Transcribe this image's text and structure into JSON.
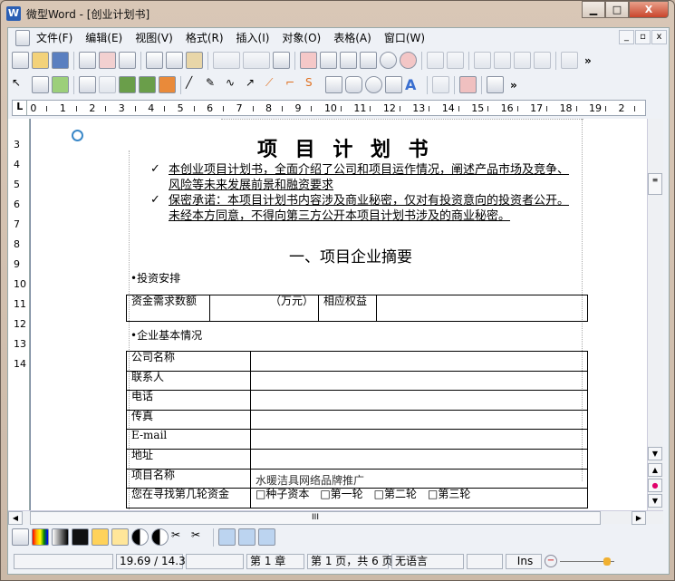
{
  "window": {
    "title": "微型Word - [创业计划书]",
    "app_icon": "W"
  },
  "menu": [
    "文件(F)",
    "编辑(E)",
    "视图(V)",
    "格式(R)",
    "插入(I)",
    "对象(O)",
    "表格(A)",
    "窗口(W)"
  ],
  "ruler": {
    "corner": "L",
    "h": [
      "0",
      "1",
      "2",
      "3",
      "4",
      "5",
      "6",
      "7",
      "8",
      "9",
      "10",
      "11",
      "12",
      "13",
      "14",
      "15",
      "16",
      "17",
      "18",
      "19",
      "2"
    ],
    "v": [
      "3",
      "4",
      "5",
      "6",
      "7",
      "8",
      "9",
      "10",
      "11",
      "12",
      "13",
      "14"
    ]
  },
  "doc": {
    "title": "项 目 计 划 书",
    "bullets": [
      "本创业项目计划书，全面介绍了公司和项目运作情况，阐述产品市场及竞争、风险等未来发展前景和融资要求",
      "保密承诺：本项目计划书内容涉及商业秘密，仅对有投资意向的投资者公开。未经本方同意，不得向第三方公开本项目计划书涉及的商业秘密。"
    ],
    "bullet_mark": "✓",
    "section": "一、项目企业摘要",
    "invest_label": "•投资安排",
    "invest_table": [
      "资金需求数额",
      "（万元）",
      "相应权益",
      ""
    ],
    "company_label": "•企业基本情况",
    "company_rows": [
      [
        "公司名称",
        ""
      ],
      [
        "联系人",
        ""
      ],
      [
        "电话",
        ""
      ],
      [
        "传真",
        ""
      ],
      [
        "E-mail",
        ""
      ],
      [
        "地址",
        ""
      ],
      [
        "项目名称",
        "水暖洁具网络品牌推广"
      ],
      [
        "您在寻找第几轮资金",
        "□种子资本　□第一轮　□第二轮　□第三轮"
      ]
    ]
  },
  "status": {
    "coords": "19.69 / 14.30",
    "chapter": "第 1 章",
    "page": "第 1 页，共 6 页",
    "lang": "无语言",
    "mode": "Ins"
  }
}
